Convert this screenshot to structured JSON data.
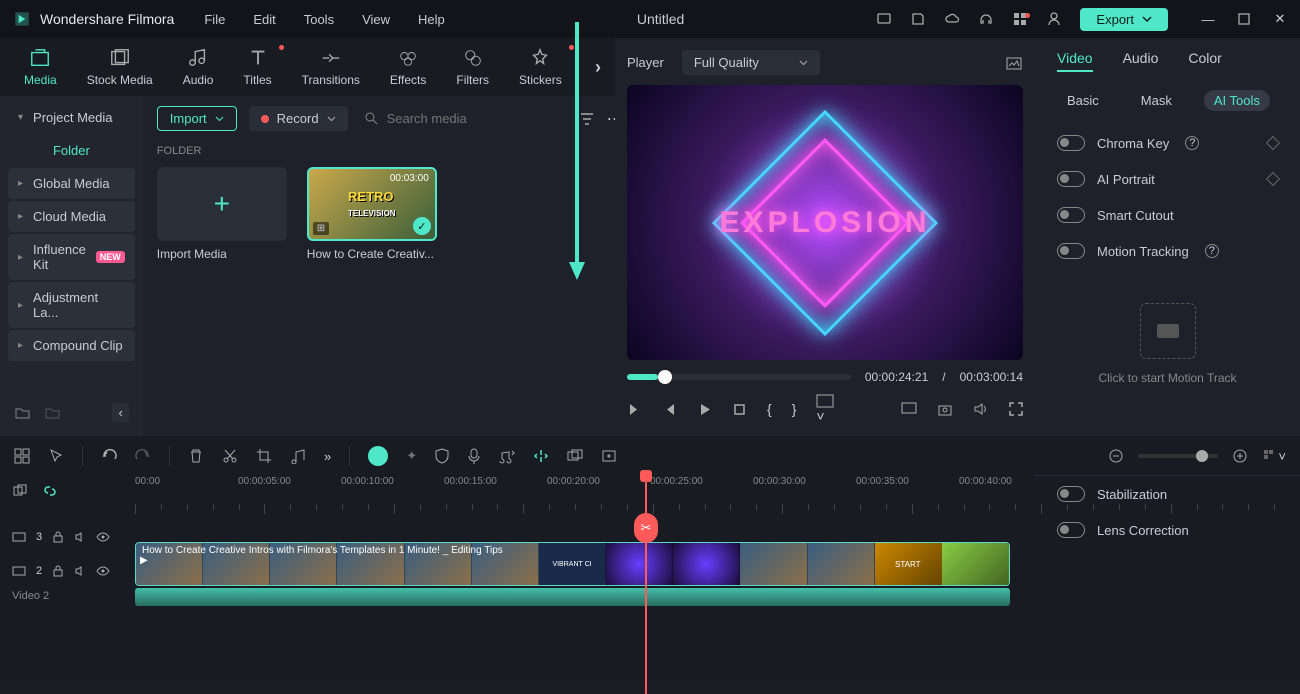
{
  "app": {
    "name": "Wondershare Filmora",
    "document": "Untitled",
    "menu": [
      "File",
      "Edit",
      "Tools",
      "View",
      "Help"
    ],
    "export": "Export"
  },
  "toolbar_tabs": [
    {
      "label": "Media",
      "active": true
    },
    {
      "label": "Stock Media"
    },
    {
      "label": "Audio"
    },
    {
      "label": "Titles",
      "dot": true
    },
    {
      "label": "Transitions"
    },
    {
      "label": "Effects"
    },
    {
      "label": "Filters"
    },
    {
      "label": "Stickers",
      "dot": true
    }
  ],
  "sidebar": {
    "project_media": "Project Media",
    "folder": "Folder",
    "items": [
      {
        "label": "Global Media"
      },
      {
        "label": "Cloud Media"
      },
      {
        "label": "Influence Kit",
        "badge": "NEW"
      },
      {
        "label": "Adjustment La..."
      },
      {
        "label": "Compound Clip"
      }
    ]
  },
  "content": {
    "import": "Import",
    "record": "Record",
    "search_ph": "Search media",
    "folder": "FOLDER",
    "import_media": "Import Media",
    "clip": {
      "name": "How to Create Creativ...",
      "dur": "00:03:00"
    }
  },
  "player": {
    "label": "Player",
    "quality": "Full Quality",
    "explosion": "EXPLOSION",
    "current": "00:00:24:21",
    "total": "00:03:00:14",
    "sep": "/"
  },
  "right": {
    "tabs": [
      "Video",
      "Audio",
      "Color"
    ],
    "subtabs": [
      "Basic",
      "Mask",
      "AI Tools"
    ],
    "items": [
      "Chroma Key",
      "AI Portrait",
      "Smart Cutout",
      "Motion Tracking"
    ],
    "motion_cta": "Click to start Motion Track",
    "bottom": [
      "Stabilization",
      "Lens Correction"
    ]
  },
  "timeline": {
    "marks": [
      "00:00",
      "00:00:05:00",
      "00:00:10:00",
      "00:00:15:00",
      "00:00:20:00",
      "00:00:25:00",
      "00:00:30:00",
      "00:00:35:00",
      "00:00:40:00"
    ],
    "track3": "3",
    "track2": "2",
    "video2": "Video 2",
    "clip_title": "How to Create Creative Intros with Filmora's Templates in 1 Minute! _ Editing Tips"
  }
}
